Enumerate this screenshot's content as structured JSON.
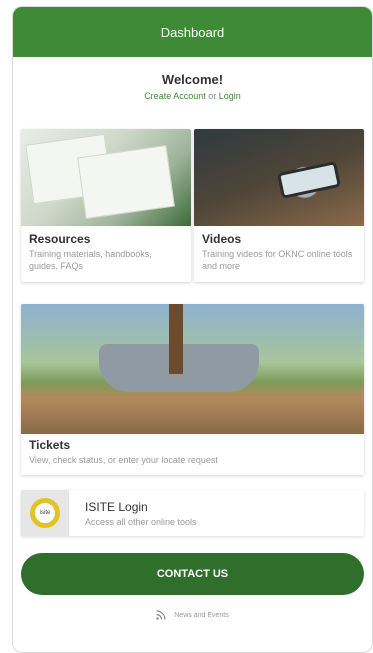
{
  "appbar": {
    "title": "Dashboard"
  },
  "welcome": {
    "title": "Welcome!",
    "create_account": "Create Account",
    "or": "or",
    "login": "Login"
  },
  "cards": [
    {
      "title": "Resources",
      "subtitle": "Training materials, handbooks, guides, FAQs"
    },
    {
      "title": "Videos",
      "subtitle": "Training videos for OKNC online tools and more"
    }
  ],
  "tickets": {
    "title": "Tickets",
    "subtitle": "View, check status, or enter your locate request"
  },
  "isite": {
    "title": "ISITE Login",
    "subtitle": "Access all other online tools",
    "logo_text": "isite"
  },
  "contact": {
    "label": "CONTACT US"
  },
  "footer": {
    "label": "News and Events",
    "icon": "rss-icon"
  },
  "colors": {
    "brand_green": "#3f8a36",
    "button_green": "#2f6e2b",
    "accent_yellow": "#e2c227"
  }
}
